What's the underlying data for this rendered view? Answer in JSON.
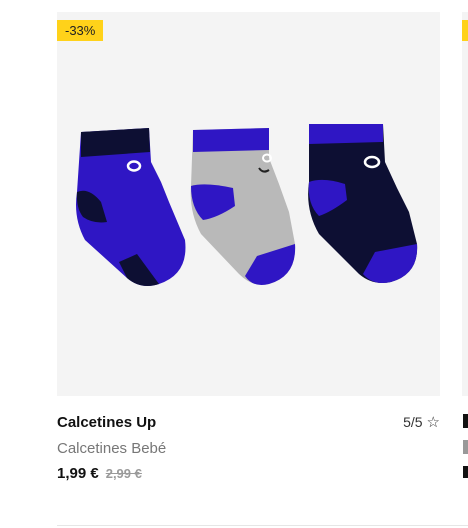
{
  "product": {
    "discount_badge": "-33%",
    "title": "Calcetines Up",
    "subtitle": "Calcetines Bebé",
    "rating": "5/5",
    "price_current": "1,99 €",
    "price_original": "2,99 €",
    "image_alt": "three baby socks"
  },
  "icons": {
    "rating": "star-outline-icon"
  },
  "colors": {
    "badge": "#ffd21a",
    "sock_blue": "#2f16c4",
    "sock_navy": "#0d0f33",
    "sock_grey": "#b9b9b9"
  }
}
